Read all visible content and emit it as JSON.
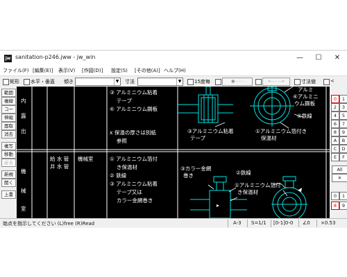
{
  "window": {
    "title": "sanitation-p246.jww - jw_win",
    "app_icon": "jw",
    "minimize": "—",
    "maximize": "☐",
    "close": "✕"
  },
  "menu": [
    "ファイル(F)",
    "[編集(E)]",
    "表示(V)",
    "[作図(D)]",
    "設定(S)",
    "[その他(A)]",
    "ヘルプ(H)"
  ],
  "toolbar": {
    "rect_label": "矩形",
    "hv_label": "水平・垂直",
    "tilt_label": "傾き",
    "tilt_value": "",
    "dim_label": "寸法",
    "dim_value": "",
    "deg15_label": "15度毎",
    "circle_btn": "●-- - -",
    "arrow_btn": "<-- - -->",
    "dimval_label": "寸法値",
    "lt_label": "<"
  },
  "left_tools": [
    {
      "label": "範囲",
      "enabled": true
    },
    {
      "label": "複線",
      "enabled": true
    },
    {
      "label": "コーナー",
      "enabled": true
    },
    {
      "label": "伸縮",
      "enabled": true
    },
    {
      "label": "面取",
      "enabled": true
    },
    {
      "label": "消去",
      "enabled": true
    },
    {
      "label": "複写",
      "enabled": true
    },
    {
      "label": "移動",
      "enabled": true
    },
    {
      "label": "戻る",
      "enabled": false
    },
    {
      "label": "新規",
      "enabled": true
    },
    {
      "label": "開く",
      "enabled": true
    },
    {
      "label": "上書",
      "enabled": true
    }
  ],
  "right_layers": {
    "col1": [
      "0",
      "2",
      "4",
      "6",
      "8",
      "A",
      "C",
      "E"
    ],
    "col2": [
      "1",
      "3",
      "5",
      "7",
      "9",
      "B",
      "D",
      "F"
    ],
    "all": "All",
    "cross": "✕",
    "group1": [
      "0",
      "1"
    ],
    "group2": [
      "8",
      "9"
    ]
  },
  "drawing": {
    "col_outdoor": [
      "内",
      "露",
      "出"
    ],
    "col_machine": [
      "機",
      "械",
      "室"
    ],
    "pipe_label_1": "給 水 管",
    "pipe_label_2": "井 水 管",
    "room_label": "機械室",
    "upper_items": [
      "③ アルミニウム粘着",
      "　 テープ",
      "④ アルミニウム鋼板",
      "",
      "x  保温の厚さは別紙",
      "　 参照"
    ],
    "lower_items": [
      "① アルミニウム箔付",
      "　 き保温材",
      "② 鉄線",
      "③ アルミニウム粘着",
      "　 テープ又は",
      "　 カラー金網巻き"
    ],
    "callouts_upper": [
      "②鉄線",
      "③アルミニウム粘着",
      "テープ",
      "①アルミニウム箔付き",
      "保温材",
      "④アルミニ",
      "ウム鋼板",
      "アルミ"
    ],
    "callouts_lower": [
      "③カラー金網",
      "巻き",
      "②鉄線",
      "①アルミニウム箔付",
      "き保温材"
    ]
  },
  "status": {
    "message": "始点を指示してください (L)free (R)Read",
    "scale_paper": "A-3",
    "scale": "S=1/1",
    "layer": "[0-1]0-0",
    "angle": "∠0",
    "zoom": "×0.53"
  }
}
